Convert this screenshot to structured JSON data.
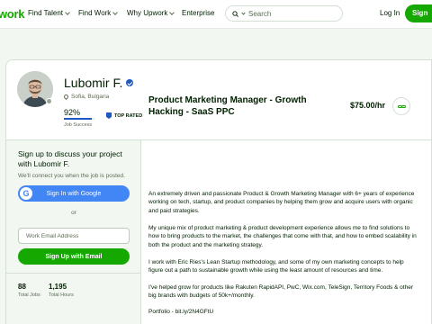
{
  "nav": {
    "logo": "work",
    "items": [
      "Find Talent",
      "Find Work",
      "Why Upwork",
      "Enterprise"
    ],
    "search_placeholder": "Search",
    "login": "Log In",
    "signup": "Sign"
  },
  "profile": {
    "name": "Lubomir F.",
    "location": "Sofia, Bulgaria",
    "job_success_value": "92%",
    "job_success_fraction": 0.92,
    "job_success_label": "Job Success",
    "badge": "TOP RATED"
  },
  "sidebar": {
    "title": "Sign up to discuss your project with Lubomir F.",
    "subtitle": "We'll connect you when the job is posted.",
    "google_button": "Sign In with Google",
    "google_letter": "G",
    "or": "or",
    "email_placeholder": "Work Email Address",
    "email_button": "Sign Up with Email",
    "stats": [
      {
        "value": "88",
        "label": "Total Jobs"
      },
      {
        "value": "1,195",
        "label": "Total Hours"
      }
    ]
  },
  "main": {
    "title": "Product Marketing Manager - Growth Hacking - SaaS PPC",
    "rate": "$75.00/hr",
    "paragraphs": [
      "An extremely driven and passionate Product & Growth Marketing Manager with 6+ years of experience working on tech, startup, and product companies by helping them grow and acquire users with organic and paid strategies.",
      "My unique mix of product marketing & product development experience allows me to find solutions to how to bring products to the market, the challenges that come with that, and how to embed scalability in both the product and the marketing strategy.",
      "I work with Eric Ries's Lean Startup methodology, and some of my own marketing concepts to help figure out a path to sustainable growth while using the least amount of resources and time.",
      "I've helped grow for products like Rakuten RapidAPI, PwC, Wix.com, TeleSign, Territory Foods & other big brands with budgets of 50k+/monthly.",
      "Portfolio - bit.ly/2N4GFtU"
    ]
  }
}
